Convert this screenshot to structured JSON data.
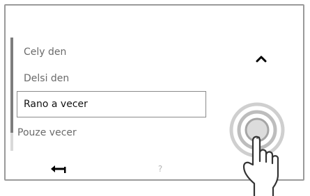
{
  "menu": {
    "items": [
      {
        "label": "Cely den"
      },
      {
        "label": "Delsi den"
      },
      {
        "label": "Rano a vecer"
      },
      {
        "label": "Pouze vecer"
      }
    ],
    "selected_index": 2
  },
  "controls": {
    "up_icon": "chevron-up-icon",
    "down_icon": "chevron-down-icon",
    "back_icon": "back-arrow-icon",
    "help_label": "?"
  },
  "scroll": {
    "position_fraction": 0.84
  },
  "colors": {
    "border": "#9a9a9a",
    "text": "#6a6a6a",
    "selected_text": "#111111",
    "accent": "#d9d9d9"
  }
}
